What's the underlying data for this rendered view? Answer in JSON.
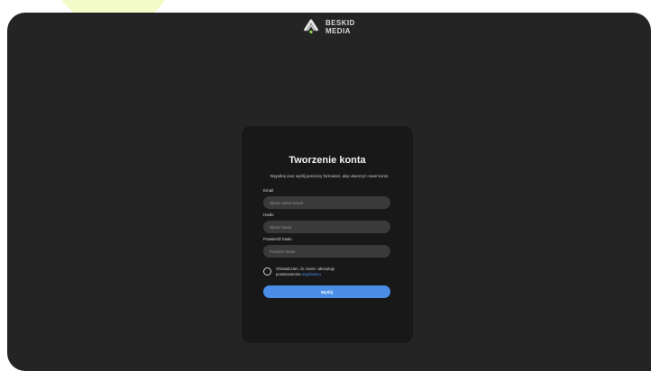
{
  "brand": {
    "line1": "BESKID",
    "line2": "MEDIA",
    "accent_color": "#4a8ee8"
  },
  "form": {
    "title": "Tworzenie konta",
    "subtitle": "Wypełnij oraz wyślij poniższy formularz, aby utworzyć nowe konto",
    "fields": [
      {
        "label": "Email",
        "placeholder": "Wpisz adres email",
        "value": ""
      },
      {
        "label": "Hasło",
        "placeholder": "Wpisz hasło",
        "value": ""
      },
      {
        "label": "Potwierdź hasło",
        "placeholder": "Powtórz hasło",
        "value": ""
      }
    ],
    "consent": {
      "prefix": "Oświadczam, że znam i akceptuję postanowienia",
      "link_text": "regulaminu"
    },
    "submit_label": "Wyślij"
  },
  "icons": {
    "logo": "beskid-media-logo-icon",
    "checkbox": "checkbox-icon"
  },
  "colors": {
    "background": "#242424",
    "card": "#181818",
    "input": "#3a3a3a",
    "link": "#4f8ff2",
    "page": "#ffffff",
    "accent_blob": "#f3fbc8"
  }
}
